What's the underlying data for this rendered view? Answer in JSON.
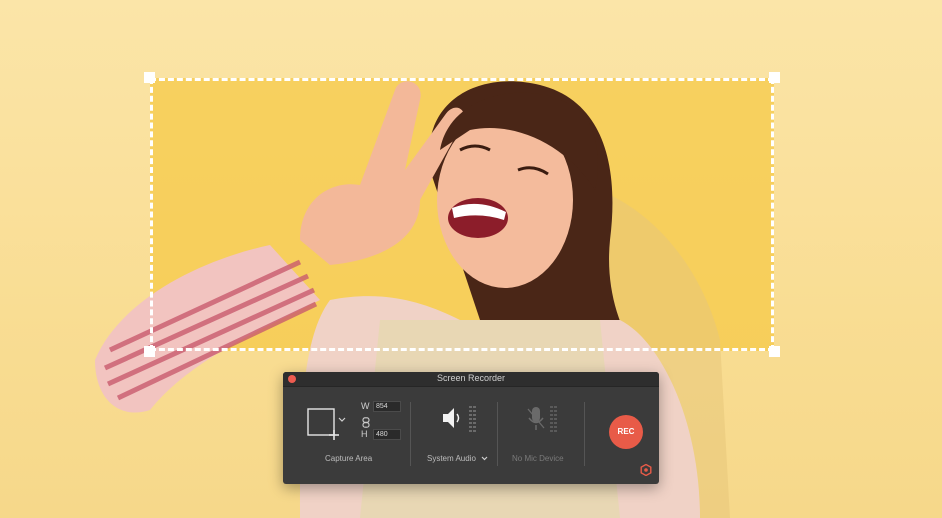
{
  "window": {
    "title": "Screen Recorder"
  },
  "capture_area": {
    "label": "Capture Area",
    "width": "854",
    "height": "480",
    "width_letter": "W",
    "height_letter": "H"
  },
  "audio": {
    "system_label": "System Audio",
    "mic_label": "No Mic Device"
  },
  "record": {
    "label": "REC"
  },
  "colors": {
    "rec": "#e85b48",
    "panel": "#3b3b3b",
    "selection": "#ffffff",
    "background": "#fbe3a1"
  },
  "icons": [
    "close-dot-icon",
    "capture-area-icon",
    "chevron-down-icon",
    "link-icon",
    "speaker-icon",
    "microphone-icon",
    "settings-icon"
  ]
}
